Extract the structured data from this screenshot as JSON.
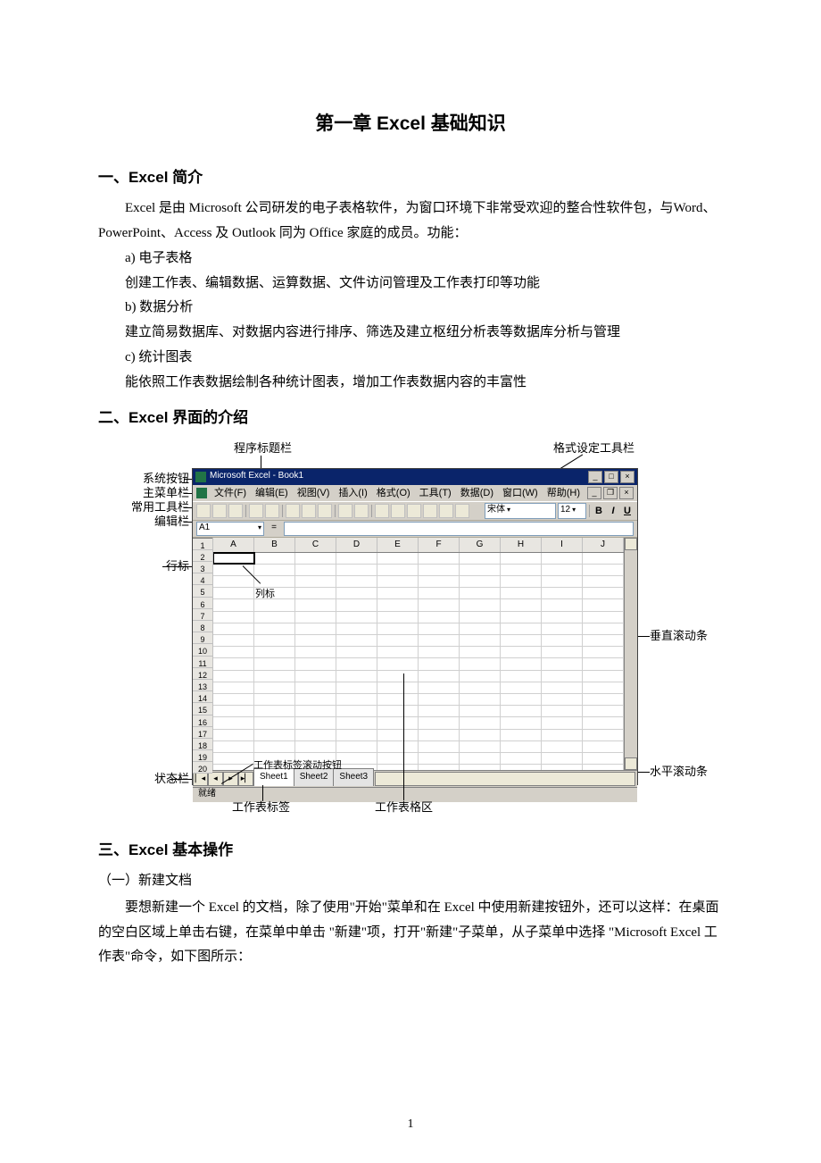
{
  "title": "第一章  Excel 基础知识",
  "section1": {
    "heading": "一、Excel 简介",
    "p1": "Excel 是由 Microsoft 公司研发的电子表格软件，为窗口环境下非常受欢迎的整合性软件包，与Word、PowerPoint、Access 及 Outlook 同为 Office 家庭的成员。功能：",
    "a_label": "a)    电子表格",
    "a_desc": "创建工作表、编辑数据、运算数据、文件访问管理及工作表打印等功能",
    "b_label": "b)    数据分析",
    "b_desc": "建立简易数据库、对数据内容进行排序、筛选及建立枢纽分析表等数据库分析与管理",
    "c_label": "c)    统计图表",
    "c_desc": "能依照工作表数据绘制各种统计图表，增加工作表数据内容的丰富性"
  },
  "section2": {
    "heading": "二、Excel 界面的介绍"
  },
  "diagram": {
    "callouts": {
      "titlebar": "程序标题栏",
      "format_toolbar": "格式设定工具栏",
      "sys_button": "系统按钮",
      "main_menu": "主菜单栏",
      "std_toolbar": "常用工具栏",
      "formula_bar": "编辑栏",
      "row_header": "行标",
      "col_header": "列标",
      "vscroll": "垂直滚动条",
      "sheet_scroll_btn": "工作表标签滚动按钮",
      "statusbar": "状态栏",
      "sheet_tab": "工作表标签",
      "cell_area": "工作表格区",
      "hscroll": "水平滚动条"
    },
    "window": {
      "title": "Microsoft Excel - Book1",
      "menus": [
        "文件(F)",
        "编辑(E)",
        "视图(V)",
        "插入(I)",
        "格式(O)",
        "工具(T)",
        "数据(D)",
        "窗口(W)",
        "帮助(H)"
      ],
      "name_box": "A1",
      "font_name": "宋体",
      "font_size": "12",
      "fmt_b": "B",
      "fmt_i": "I",
      "fmt_u": "U",
      "columns": [
        "A",
        "B",
        "C",
        "D",
        "E",
        "F",
        "G",
        "H",
        "I",
        "J"
      ],
      "row_count": 20,
      "tabs": [
        "Sheet1",
        "Sheet2",
        "Sheet3"
      ],
      "status": "就绪"
    }
  },
  "section3": {
    "heading": "三、Excel 基本操作",
    "sub1": "（一）新建文档",
    "p1": "要想新建一个 Excel 的文档，除了使用\"开始\"菜单和在 Excel 中使用新建按钮外，还可以这样：在桌面的空白区域上单击右键，在菜单中单击  \"新建\"项，打开\"新建\"子菜单，从子菜单中选择 \"Microsoft Excel  工作表\"命令，如下图所示："
  },
  "page_number": "1"
}
